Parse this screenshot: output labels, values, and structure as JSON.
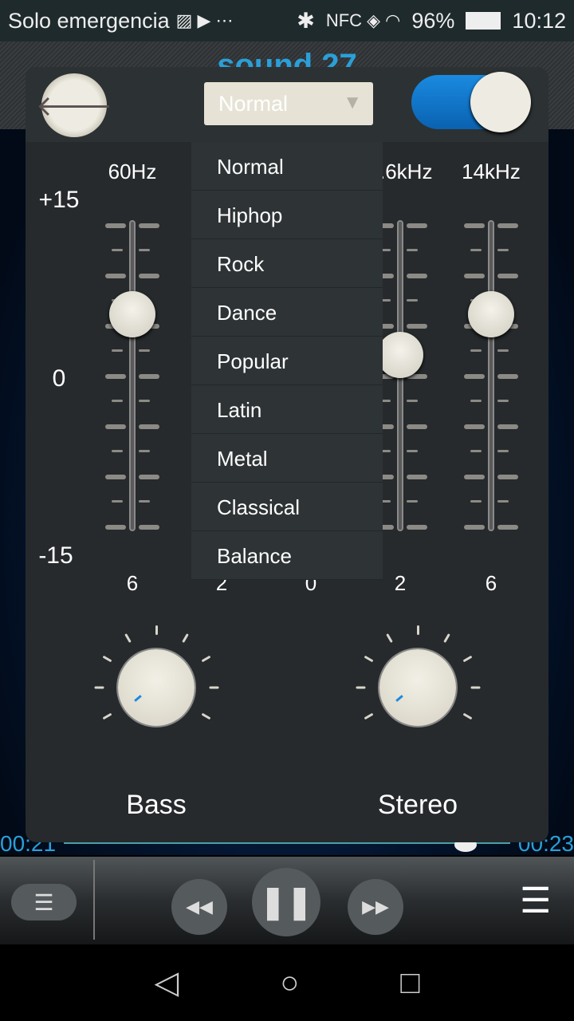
{
  "status": {
    "carrier": "Solo emergencia",
    "battery": "96%",
    "time": "10:12",
    "icons": [
      "image-icon",
      "play-icon",
      "more-icon",
      "bluetooth-icon",
      "nfc-icon",
      "vibrate-icon",
      "wifi-icon",
      "sim-icon",
      "battery-icon"
    ]
  },
  "player": {
    "song_title": "sound 27",
    "elapsed": "00:21",
    "total": "00:23",
    "progress": 0.9
  },
  "equalizer": {
    "enabled": true,
    "preset": "Normal",
    "scale": {
      "max": "+15",
      "mid": "0",
      "min": "-15"
    },
    "bands": [
      {
        "label": "60Hz",
        "value": 6,
        "value_label": "6"
      },
      {
        "label": "",
        "value": 2,
        "value_label": "2"
      },
      {
        "label": "",
        "value": 0,
        "value_label": "0"
      },
      {
        "label": "3.6kHz",
        "value": 2,
        "value_label": "2"
      },
      {
        "label": "14kHz",
        "value": 6,
        "value_label": "6"
      }
    ],
    "presets": [
      "Normal",
      "Hiphop",
      "Rock",
      "Dance",
      "Popular",
      "Latin",
      "Metal",
      "Classical",
      "Balance"
    ],
    "bass_label": "Bass",
    "stereo_label": "Stereo",
    "accent": "#1a8ae0"
  }
}
